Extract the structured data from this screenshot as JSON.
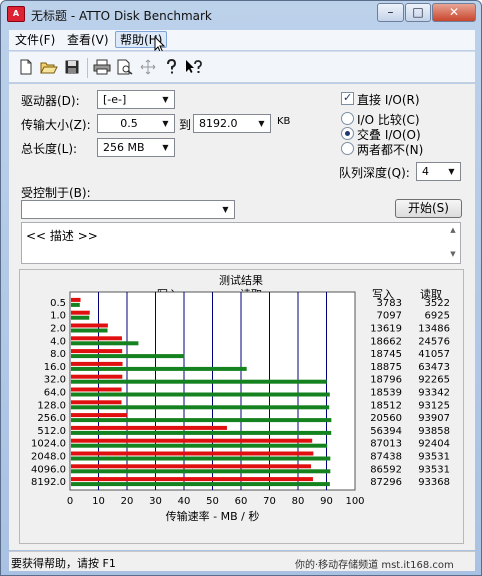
{
  "window": {
    "title": "无标题 - ATTO Disk Benchmark"
  },
  "window_buttons": {
    "minimize": "–",
    "maximize": "□",
    "close": "✕"
  },
  "menu": {
    "items": [
      "文件(F)",
      "查看(V)",
      "帮助(H)"
    ]
  },
  "form": {
    "drive_label": "驱动器(D):",
    "drive_value": "[-e-]",
    "transfer_label": "传输大小(Z):",
    "transfer_from": "0.5",
    "to_label": "到",
    "transfer_to": "8192.0",
    "kb_label": "KB",
    "length_label": "总长度(L):",
    "length_value": "256 MB",
    "direct_io_label": "直接 I/O(R)",
    "io_compare_label": "I/O 比较(C)",
    "overlapped_io_label": "交叠 I/O(O)",
    "neither_label": "两者都不(N)",
    "queue_label": "队列深度(Q):",
    "queue_value": "4",
    "controlled_label": "受控制于(B):",
    "controlled_value": "",
    "start_button": "开始(S)",
    "description": "<< 描述 >>"
  },
  "chart_data": {
    "type": "bar",
    "title": "测试结果",
    "legend_write": "写入",
    "legend_read": "读取",
    "col_write": "写入",
    "col_read": "读取",
    "xlabel": "传输速率 - MB / 秒",
    "xlim": [
      0,
      100
    ],
    "xticks": [
      "0",
      "10",
      "20",
      "30",
      "40",
      "50",
      "60",
      "70",
      "80",
      "90",
      "100"
    ],
    "categories": [
      "0.5",
      "1.0",
      "2.0",
      "4.0",
      "8.0",
      "16.0",
      "32.0",
      "64.0",
      "128.0",
      "256.0",
      "512.0",
      "1024.0",
      "2048.0",
      "4096.0",
      "8192.0"
    ],
    "series": [
      {
        "name": "写入",
        "values": [
          3783,
          7097,
          13619,
          18662,
          18745,
          18875,
          18796,
          18539,
          18512,
          20560,
          56394,
          87013,
          87438,
          86592,
          87296
        ]
      },
      {
        "name": "读取",
        "values": [
          3522,
          6925,
          13486,
          24576,
          41057,
          63473,
          92265,
          93342,
          93125,
          93907,
          93858,
          92404,
          93531,
          93531,
          93368
        ]
      }
    ],
    "colors": {
      "write": "#e01010",
      "read": "#14821e",
      "grid": "#00007a"
    }
  },
  "status": {
    "help_text": "要获得帮助，请按 F1",
    "watermark": "你的·移动存储频道 mst.it168.com"
  }
}
